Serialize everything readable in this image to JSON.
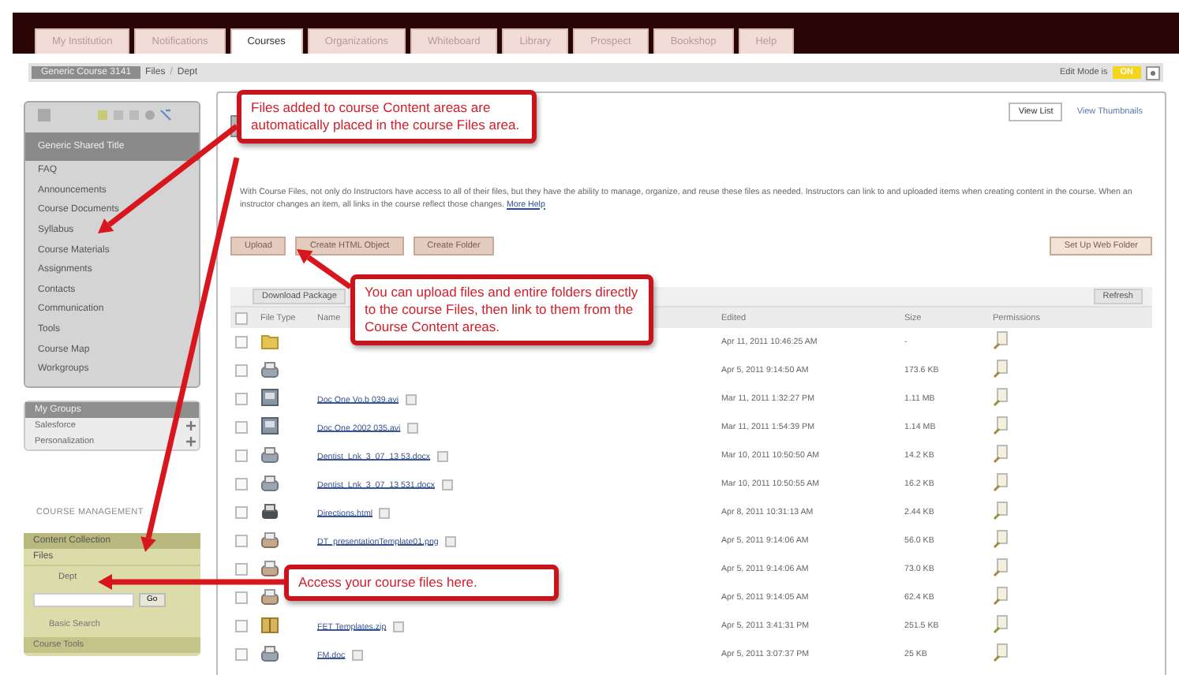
{
  "tabs": [
    {
      "label": "My Institution",
      "selected": false
    },
    {
      "label": "Notifications",
      "selected": false
    },
    {
      "label": "Courses",
      "selected": true
    },
    {
      "label": "Organizations",
      "selected": false
    },
    {
      "label": "Whiteboard",
      "selected": false
    },
    {
      "label": "Library",
      "selected": false
    },
    {
      "label": "Prospect",
      "selected": false
    },
    {
      "label": "Bookshop",
      "selected": false
    },
    {
      "label": "Help",
      "selected": false
    }
  ],
  "breadcrumb": {
    "course": "Generic Course 3141",
    "path": [
      "Files",
      "Dept"
    ],
    "separator": "/"
  },
  "edit_mode": {
    "label": "Edit Mode is",
    "on": true,
    "state_text": "ON"
  },
  "course_menu": {
    "title": "Generic Shared Title",
    "items": [
      "FAQ",
      "Announcements",
      "Course Documents",
      "Syllabus",
      "Course Materials",
      "Assignments",
      "Contacts",
      "Communication",
      "Tools",
      "Course Map",
      "Workgroups"
    ]
  },
  "my_groups": {
    "title": "My Groups",
    "items": [
      "Salesforce",
      "Personalization"
    ]
  },
  "course_management": {
    "heading": "COURSE MANAGEMENT",
    "panel_title": "Content Collection",
    "folder": "Files",
    "subfolder": "Dept",
    "go": "Go",
    "basic_search": "Basic Search",
    "course_tools": "Course Tools"
  },
  "view_buttons": [
    {
      "label": "View List",
      "selected": true
    },
    {
      "label": "View Thumbnails",
      "selected": false
    }
  ],
  "description": "With Course Files, not only do Instructors have access to all of their files, but they have the ability to manage, organize, and reuse these files as needed. Instructors can link to and uploaded items when creating content in the course. When an instructor changes an item, all links in the course reflect those changes.",
  "more_help": "More Help",
  "action_buttons": [
    "Upload",
    "Create HTML Object",
    "Create Folder"
  ],
  "web_folder_button": "Set Up Web Folder",
  "table": {
    "toolbar": "Download Package",
    "refresh": "Refresh",
    "select_all_checked": false,
    "columns": [
      "File Type",
      "Name",
      "Edited",
      "Size",
      "Permissions"
    ],
    "rows": [
      {
        "kind": "folder",
        "checked": false,
        "edited": "Apr 11, 2011 10:46:25 AM",
        "size": "-"
      },
      {
        "kind": "document",
        "checked": false,
        "edited": "Apr 5, 2011 9:14:50 AM",
        "size": "173.6 KB"
      },
      {
        "kind": "media",
        "checked": false,
        "name": "Doc One Vo.b 039.avi",
        "edited": "Mar 11, 2011 1:32:27 PM",
        "size": "1.11 MB"
      },
      {
        "kind": "media",
        "checked": false,
        "name": "Doc One 2002 035.avi",
        "edited": "Mar 11, 2011 1:54:39 PM",
        "size": "1.14 MB"
      },
      {
        "kind": "document",
        "checked": false,
        "name": "Dentist_Lnk_3_07_13 53.docx",
        "edited": "Mar 10, 2011 10:50:50 AM",
        "size": "14.2 KB"
      },
      {
        "kind": "document",
        "checked": false,
        "name": "Dentist_Lnk_3_07_13 531.docx",
        "edited": "Mar 10, 2011 10:50:55 AM",
        "size": "16.2 KB"
      },
      {
        "kind": "web",
        "checked": false,
        "name": "Directions.html",
        "edited": "Apr 8, 2011 10:31:13 AM",
        "size": "2.44 KB"
      },
      {
        "kind": "image",
        "checked": false,
        "name": "DT_presentationTemplate01.png",
        "edited": "Apr 5, 2011 9:14:06 AM",
        "size": "56.0 KB"
      },
      {
        "kind": "image",
        "checked": false,
        "edited": "Apr 5, 2011 9:14:06 AM",
        "size": "73.0 KB"
      },
      {
        "kind": "image",
        "checked": false,
        "edited": "Apr 5, 2011 9:14:05 AM",
        "size": "62.4 KB"
      },
      {
        "kind": "archive",
        "checked": false,
        "name": "FET Templates.zip",
        "edited": "Apr 5, 2011 3:41:31 PM",
        "size": "251.5 KB"
      },
      {
        "kind": "document",
        "checked": false,
        "name": "FM.doc",
        "edited": "Apr 5, 2011 3:07:37 PM",
        "size": "25 KB"
      }
    ]
  },
  "callouts": [
    {
      "text": "Files added to course Content areas are automatically placed in the course Files area."
    },
    {
      "text": "You can upload files and entire folders directly to the course Files, then link to them from the Course Content areas."
    },
    {
      "text": "Access your course files here."
    }
  ]
}
